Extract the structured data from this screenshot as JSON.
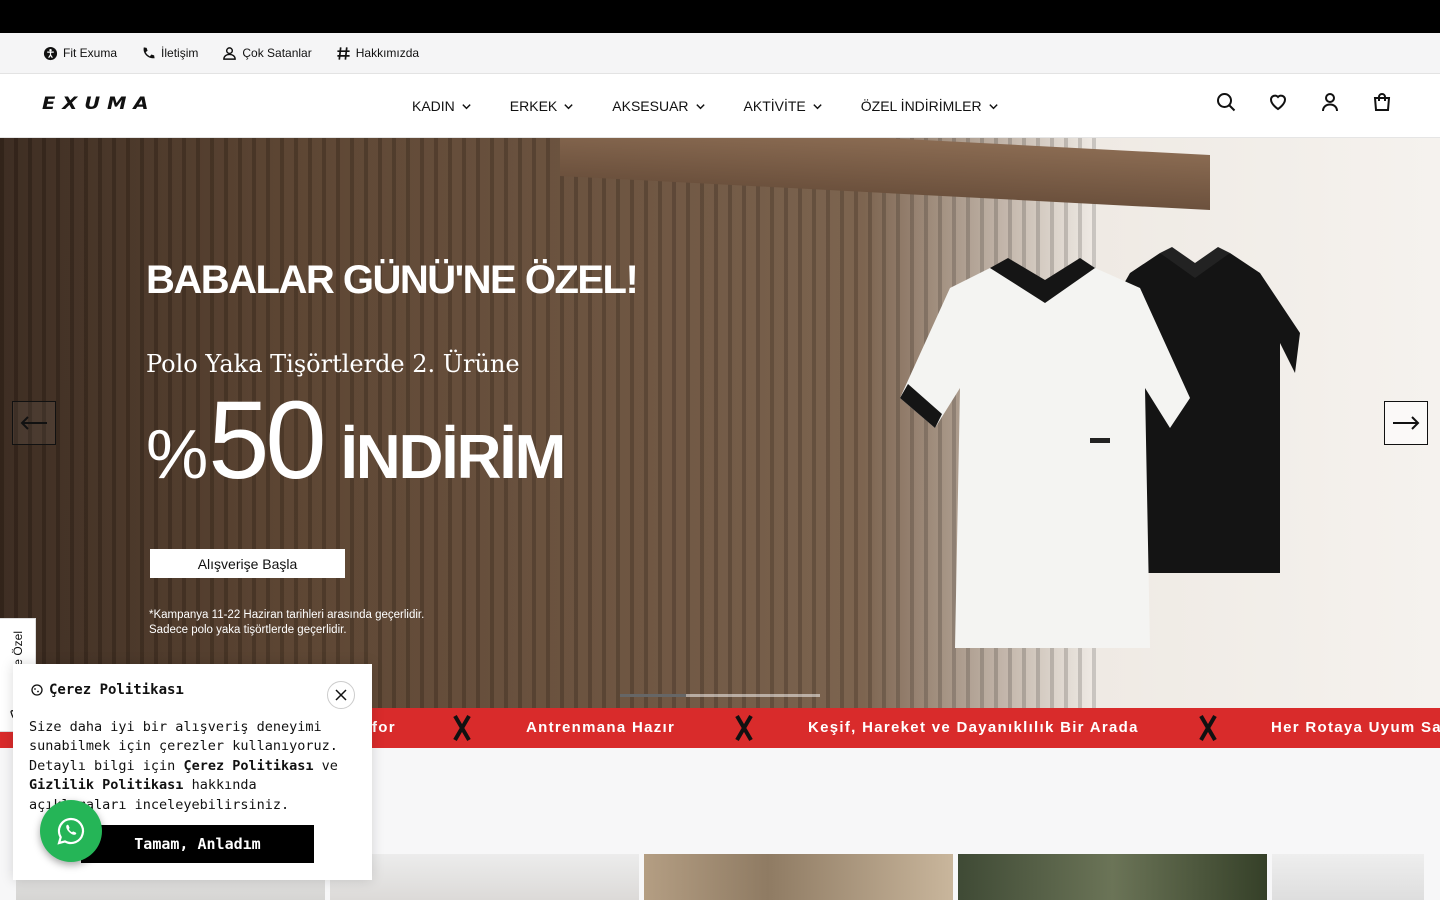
{
  "utility_nav": [
    {
      "label": "Fit Exuma",
      "icon": "accessibility-icon"
    },
    {
      "label": "İletişim",
      "icon": "phone-icon"
    },
    {
      "label": "Çok Satanlar",
      "icon": "user-icon"
    },
    {
      "label": "Hakkımızda",
      "icon": "hash-icon"
    }
  ],
  "header": {
    "logo_text": "EXUMA",
    "nav": [
      {
        "label": "KADIN"
      },
      {
        "label": "ERKEK"
      },
      {
        "label": "AKSESUAR"
      },
      {
        "label": "AKTİVİTE"
      },
      {
        "label": "ÖZEL İNDİRİMLER"
      }
    ],
    "icons": [
      "search-icon",
      "heart-icon",
      "account-icon",
      "cart-icon"
    ]
  },
  "hero": {
    "title": "BABALAR GÜNÜ'NE ÖZEL!",
    "subtitle": "Polo Yaka Tişörtlerde 2. Ürüne",
    "percent_sign": "%",
    "discount": "50",
    "discount_word": "İNDİRİM",
    "cta_label": "Alışverişe Başla",
    "note_line1": "*Kampanya 11-22 Haziran tarihleri arasında geçerlidir.",
    "note_line2": "Sadece polo yaka tişörtlerde geçerlidir.",
    "slide_progress": 0.33
  },
  "marquee": {
    "items": [
      "for",
      "Antrenmana Hazır",
      "Keşif, Hareket ve Dayanıklılık Bir Arada",
      "Her Rotaya Uyum Sa"
    ],
    "background": "#d92b2b"
  },
  "side_tab": {
    "label": "Size Özel"
  },
  "cookie": {
    "title": "Çerez Politikası",
    "body_part1": "Size daha iyi bir alışveriş deneyimi sunabilmek için çerezler kullanıyoruz. Detaylı bilgi için ",
    "link1": "Çerez Politikası",
    "body_part2": " ve ",
    "link2": "Gizlilik Politikası",
    "body_part3": " hakkında açıklamaları inceleyebilirsiniz.",
    "button_label": "Tamam, Anladım"
  }
}
